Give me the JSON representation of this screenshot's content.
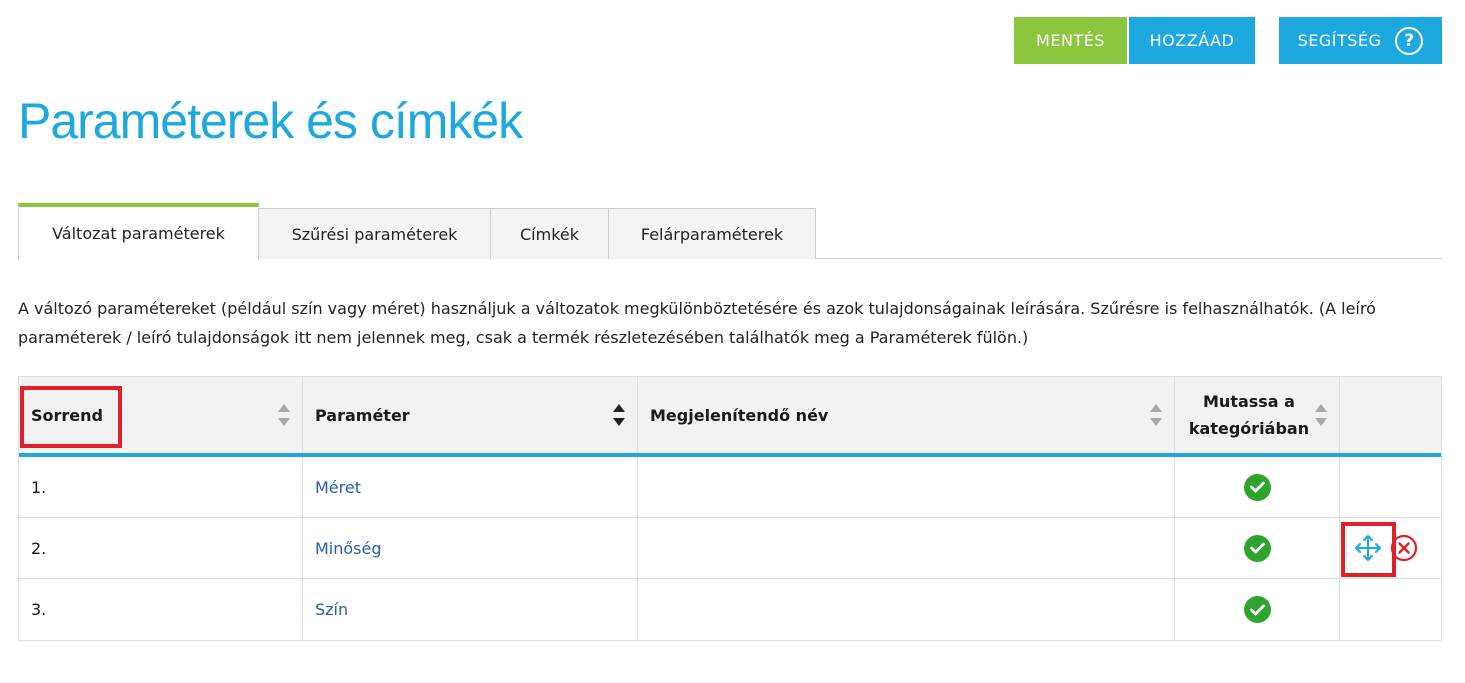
{
  "toolbar": {
    "save_label": "MENTÉS",
    "add_label": "HOZZÁAD",
    "help_label": "SEGÍTSÉG",
    "help_icon": "?"
  },
  "page": {
    "title": "Paraméterek és címkék"
  },
  "tabs": [
    {
      "label": "Változat paraméterek",
      "active": true
    },
    {
      "label": "Szűrési paraméterek",
      "active": false
    },
    {
      "label": "Címkék",
      "active": false
    },
    {
      "label": "Felárparaméterek",
      "active": false
    }
  ],
  "description": "A változó paramétereket (például szín vagy méret) használjuk a változatok megkülönböztetésére és azok tulajdonságainak leírására. Szűrésre is felhasználhatók. (A leíró paraméterek / leíró tulajdonságok itt nem jelennek meg, csak a termék részletezésében találhatók meg a Paraméterek fülön.)",
  "table": {
    "headers": {
      "order": "Sorrend",
      "parameter": "Paraméter",
      "display_name": "Megjelenítendő név",
      "show_in_category_line1": "Mutassa a",
      "show_in_category_line2": "kategóriában"
    },
    "rows": [
      {
        "order": "1.",
        "parameter": "Méret",
        "display_name": "",
        "show_in_category": true,
        "actions_visible": false
      },
      {
        "order": "2.",
        "parameter": "Minőség",
        "display_name": "",
        "show_in_category": true,
        "actions_visible": true
      },
      {
        "order": "3.",
        "parameter": "Szín",
        "display_name": "",
        "show_in_category": true,
        "actions_visible": false
      }
    ]
  },
  "colors": {
    "accent_blue": "#1ea8e0",
    "accent_green": "#8cc63f",
    "check_green": "#2ea32e",
    "highlight_red": "#e0202a",
    "delete_red": "#e0202a"
  },
  "icons": {
    "help": "help-circle-icon",
    "sort": "sort-icon",
    "check": "check-circle-icon",
    "move": "move-arrows-icon",
    "delete": "delete-circle-icon"
  }
}
